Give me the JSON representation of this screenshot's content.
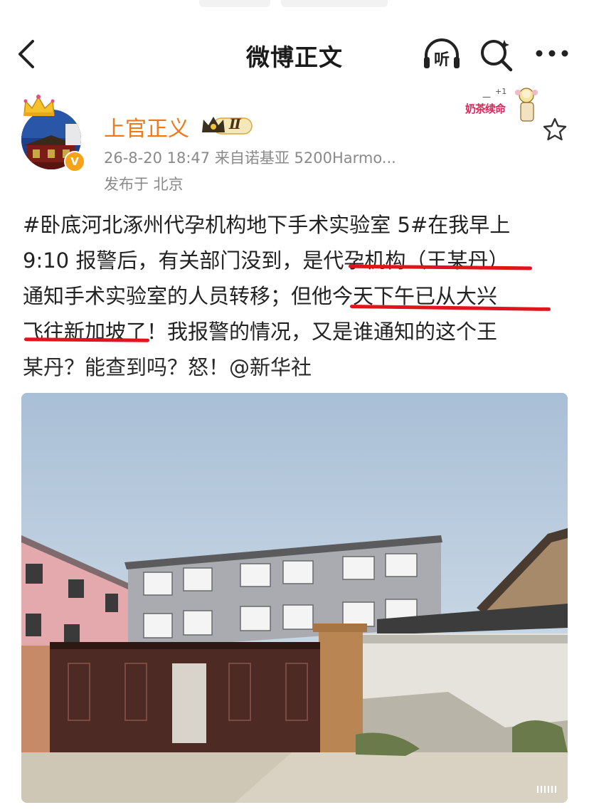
{
  "navbar": {
    "title": "微博正文",
    "listen_label": "听"
  },
  "author": {
    "name": "上官正义",
    "level": "Ⅱ",
    "verified_mark": "V"
  },
  "post": {
    "meta": "26-8-20 18:47  来自诺基亚 5200Harmo...",
    "location": "发布于 北京",
    "lines": [
      "#卧底河北涿州代孕机构地下手术实验室 5#在我早上",
      "9:10 报警后，有关部门没到，是代孕机构（王某丹）",
      "通知手术实验室的人员转移；但他今天下午已从大兴",
      "飞往新加坡了！我报警的情况，又是谁通知的这个王",
      "某丹？能查到吗？怒！@新华社"
    ]
  },
  "sticker": {
    "text": "奶茶续命",
    "plus": "+1"
  },
  "colors": {
    "accent_orange": "#f07a1a",
    "highlight_red": "#e0141b",
    "meta_gray": "#8a8a8a"
  },
  "icons": {
    "back": "chevron-left-icon",
    "listen": "headphones-icon",
    "search": "search-sparkle-icon",
    "more": "more-dots-icon",
    "favorite": "star-outline-icon"
  }
}
